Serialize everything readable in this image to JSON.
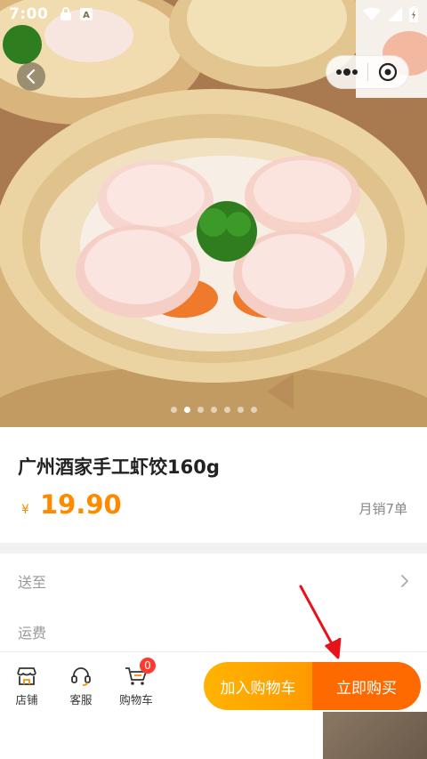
{
  "status_bar": {
    "time": "7:00"
  },
  "product": {
    "title": "广州酒家手工虾饺160g",
    "currency": "¥",
    "price": "19.90",
    "sales": "月销7单"
  },
  "carousel": {
    "count": 7,
    "active_index": 1
  },
  "options": {
    "ship_to_label": "送至",
    "shipping_fee_label": "运费"
  },
  "bottom_bar": {
    "store_label": "店铺",
    "service_label": "客服",
    "cart_label": "购物车",
    "cart_count": "0",
    "add_to_cart_label": "加入购物车",
    "buy_now_label": "立即购买"
  },
  "colors": {
    "accent_orange": "#ff8a00",
    "buy_button": "#ff6a00",
    "add_button": "#ffa800",
    "badge_red": "#ff3b30"
  }
}
